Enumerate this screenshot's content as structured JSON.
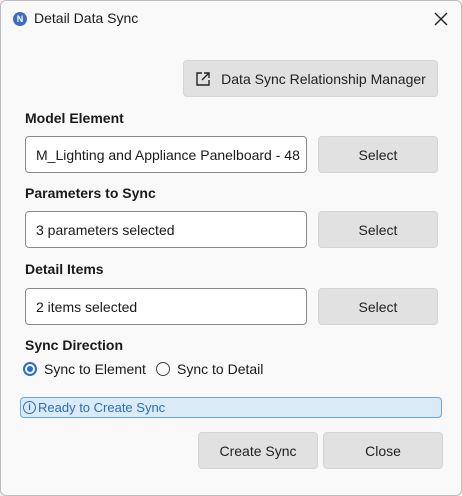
{
  "window": {
    "title": "Detail Data Sync",
    "app_icon_letter": "N"
  },
  "relationship_manager": {
    "label": "Data Sync Relationship Manager",
    "icon": "external-link-icon"
  },
  "model_element": {
    "heading": "Model Element",
    "value": "M_Lighting and Appliance Panelboard - 48",
    "select_label": "Select"
  },
  "parameters": {
    "heading": "Parameters to Sync",
    "value": "3 parameters selected",
    "select_label": "Select"
  },
  "detail_items": {
    "heading": "Detail Items",
    "value": "2 items selected",
    "select_label": "Select"
  },
  "sync_direction": {
    "heading": "Sync Direction",
    "options": [
      {
        "label": "Sync to Element",
        "selected": true
      },
      {
        "label": "Sync to Detail",
        "selected": false
      }
    ]
  },
  "status": {
    "text": "Ready to Create Sync",
    "icon": "info-icon",
    "color": "#2a6fb3"
  },
  "footer": {
    "create_label": "Create Sync",
    "close_label": "Close"
  }
}
